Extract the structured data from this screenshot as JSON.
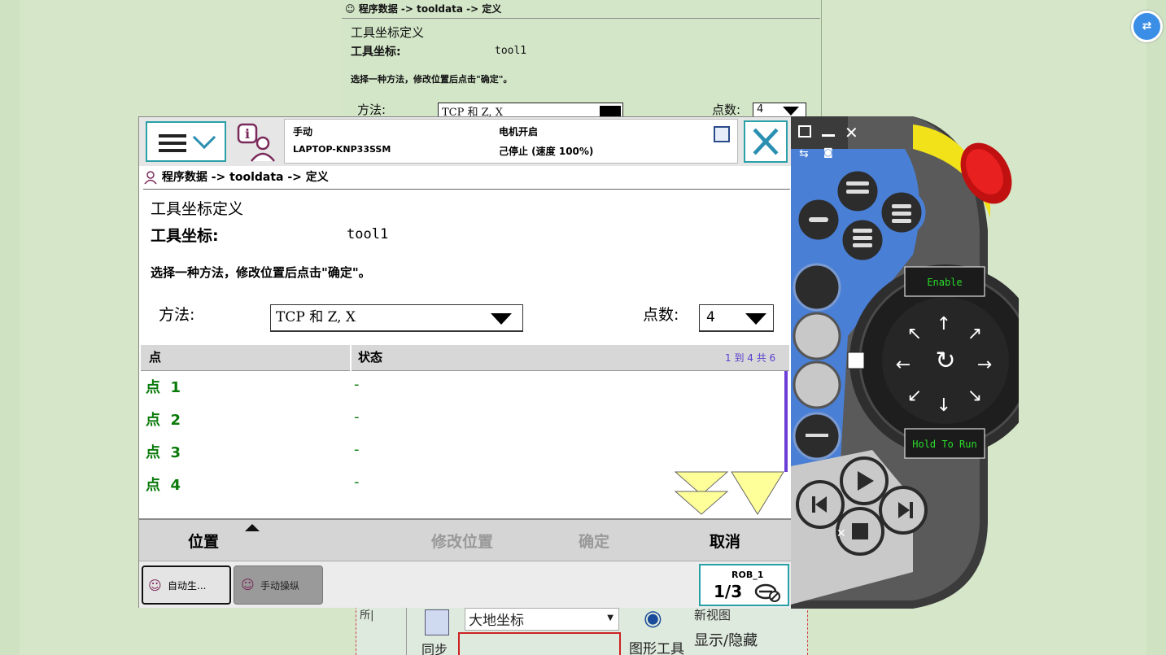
{
  "ghost": {
    "breadcrumb": "程序数据 -> tooldata -> 定义",
    "title": "工具坐标定义",
    "tool_label": "工具坐标:",
    "tool_value": "tool1",
    "instruction": "选择一种方法，修改位置后点击\"确定\"。",
    "method_label": "方法:",
    "method_value": "TCP 和 Z, X",
    "points_label": "点数:",
    "points_value": "4"
  },
  "ribbon": {
    "sync": "同步",
    "coord": "大地坐标",
    "graphics_tools": "图形工具",
    "new_view": "新视图",
    "show_hide": "显示/隐藏"
  },
  "topbar": {
    "mode": "手动",
    "controller": "LAPTOP-KNP33SSM",
    "motor": "电机开启",
    "state": "己停止 (速度 100%)"
  },
  "breadcrumb": "程序数据 -> tooldata -> 定义",
  "page": {
    "title": "工具坐标定义",
    "tool_label": "工具坐标:",
    "tool_value": "tool1",
    "instruction": "选择一种方法，修改位置后点击\"确定\"。",
    "method_label": "方法:",
    "method_value": "TCP 和 Z, X",
    "points_label": "点数:",
    "points_value": "4"
  },
  "table": {
    "col_point": "点",
    "col_status": "状态",
    "count": "1 到 4 共 6",
    "rows": [
      {
        "point": "点  1",
        "status": "-"
      },
      {
        "point": "点  2",
        "status": "-"
      },
      {
        "point": "点  3",
        "status": "-"
      },
      {
        "point": "点  4",
        "status": "-"
      }
    ]
  },
  "actions": {
    "position": "位置",
    "modify_position": "修改位置",
    "ok": "确定",
    "cancel": "取消"
  },
  "taskbar": {
    "task1": "自动生...",
    "task2": "手动操纵",
    "rob_label": "ROB_1",
    "rob_fraction": "1/3"
  },
  "hw": {
    "enable": "Enable",
    "hold_to_run": "Hold To Run"
  },
  "colors": {
    "accent": "#2aa0a8",
    "green_text": "#0a7a0a",
    "scroll": "#6a3dd6",
    "hw_body": "#3a3a3a",
    "hw_blue": "#4a7fd6",
    "estop": "#e01818",
    "estop_ring": "#f2e21a"
  }
}
